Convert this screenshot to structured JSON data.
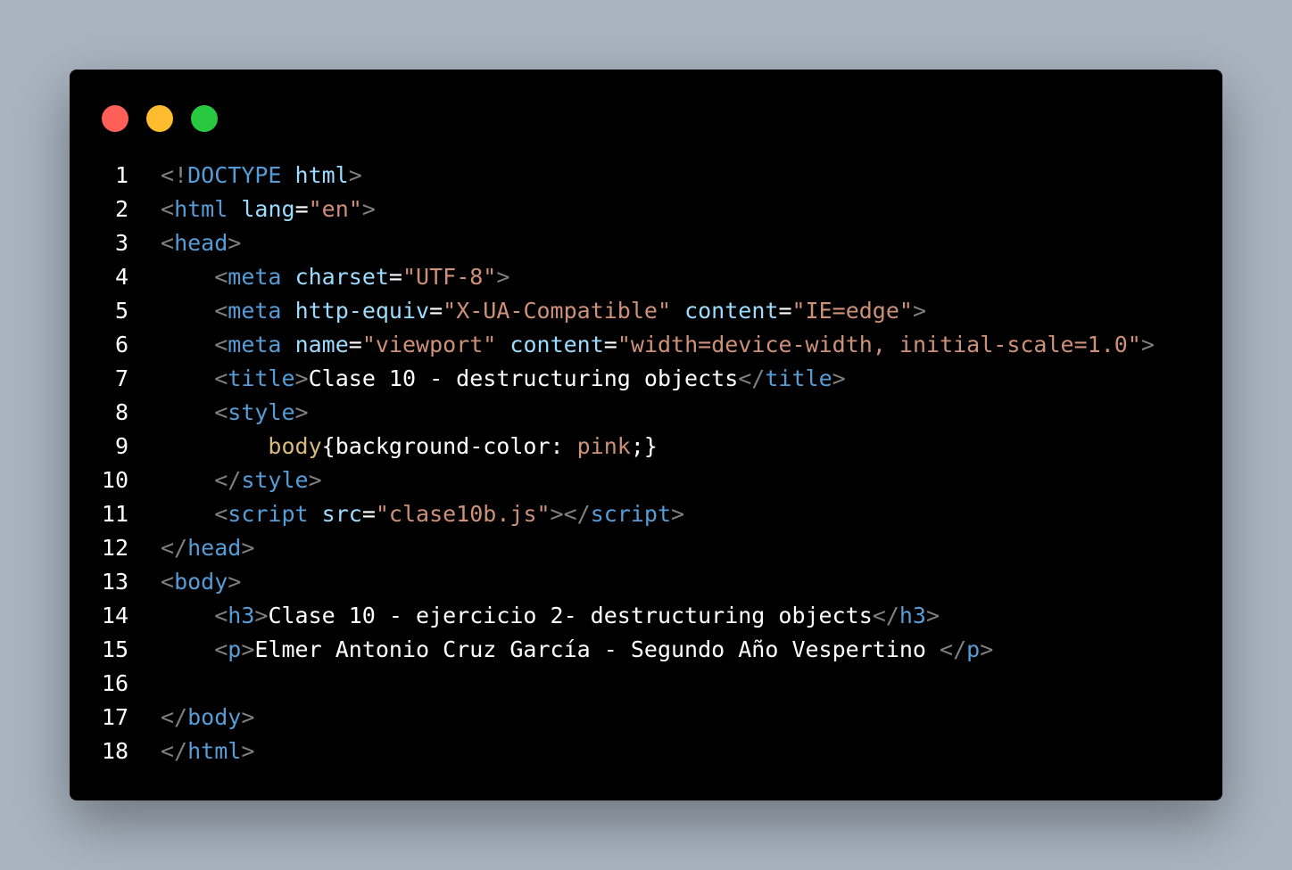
{
  "window": {
    "controls": [
      "close",
      "minimize",
      "maximize"
    ],
    "control_colors": {
      "close": "#ff5f57",
      "minimize": "#febc2e",
      "maximize": "#28c840"
    }
  },
  "code": {
    "lines": [
      {
        "number": "1",
        "tokens": [
          [
            "br",
            "<!"
          ],
          [
            "tg",
            "DOCTYPE"
          ],
          [
            "tx",
            " "
          ],
          [
            "at",
            "html"
          ],
          [
            "br",
            ">"
          ]
        ]
      },
      {
        "number": "2",
        "tokens": [
          [
            "br",
            "<"
          ],
          [
            "tg",
            "html"
          ],
          [
            "tx",
            " "
          ],
          [
            "at",
            "lang"
          ],
          [
            "tx",
            "="
          ],
          [
            "st",
            "\"en\""
          ],
          [
            "br",
            ">"
          ]
        ]
      },
      {
        "number": "3",
        "tokens": [
          [
            "br",
            "<"
          ],
          [
            "tg",
            "head"
          ],
          [
            "br",
            ">"
          ]
        ]
      },
      {
        "number": "4",
        "tokens": [
          [
            "tx",
            "    "
          ],
          [
            "br",
            "<"
          ],
          [
            "tg",
            "meta"
          ],
          [
            "tx",
            " "
          ],
          [
            "at",
            "charset"
          ],
          [
            "tx",
            "="
          ],
          [
            "st",
            "\"UTF-8\""
          ],
          [
            "br",
            ">"
          ]
        ]
      },
      {
        "number": "5",
        "tokens": [
          [
            "tx",
            "    "
          ],
          [
            "br",
            "<"
          ],
          [
            "tg",
            "meta"
          ],
          [
            "tx",
            " "
          ],
          [
            "at",
            "http-equiv"
          ],
          [
            "tx",
            "="
          ],
          [
            "st",
            "\"X-UA-Compatible\""
          ],
          [
            "tx",
            " "
          ],
          [
            "at",
            "content"
          ],
          [
            "tx",
            "="
          ],
          [
            "st",
            "\"IE=edge\""
          ],
          [
            "br",
            ">"
          ]
        ]
      },
      {
        "number": "6",
        "tokens": [
          [
            "tx",
            "    "
          ],
          [
            "br",
            "<"
          ],
          [
            "tg",
            "meta"
          ],
          [
            "tx",
            " "
          ],
          [
            "at",
            "name"
          ],
          [
            "tx",
            "="
          ],
          [
            "st",
            "\"viewport\""
          ],
          [
            "tx",
            " "
          ],
          [
            "at",
            "content"
          ],
          [
            "tx",
            "="
          ],
          [
            "st",
            "\"width=device-width, initial-scale=1.0\""
          ],
          [
            "br",
            ">"
          ]
        ]
      },
      {
        "number": "7",
        "tokens": [
          [
            "tx",
            "    "
          ],
          [
            "br",
            "<"
          ],
          [
            "tg",
            "title"
          ],
          [
            "br",
            ">"
          ],
          [
            "tx",
            "Clase 10 - destructuring objects"
          ],
          [
            "br",
            "</"
          ],
          [
            "tg",
            "title"
          ],
          [
            "br",
            ">"
          ]
        ]
      },
      {
        "number": "8",
        "tokens": [
          [
            "tx",
            "    "
          ],
          [
            "br",
            "<"
          ],
          [
            "tg",
            "style"
          ],
          [
            "br",
            ">"
          ]
        ]
      },
      {
        "number": "9",
        "tokens": [
          [
            "tx",
            "        "
          ],
          [
            "sl",
            "body"
          ],
          [
            "tx",
            "{background-color: "
          ],
          [
            "st",
            "pink"
          ],
          [
            "tx",
            ";}"
          ]
        ]
      },
      {
        "number": "10",
        "tokens": [
          [
            "tx",
            "    "
          ],
          [
            "br",
            "</"
          ],
          [
            "tg",
            "style"
          ],
          [
            "br",
            ">"
          ]
        ]
      },
      {
        "number": "11",
        "tokens": [
          [
            "tx",
            "    "
          ],
          [
            "br",
            "<"
          ],
          [
            "tg",
            "script"
          ],
          [
            "tx",
            " "
          ],
          [
            "at",
            "src"
          ],
          [
            "tx",
            "="
          ],
          [
            "st",
            "\"clase10b.js\""
          ],
          [
            "br",
            "></"
          ],
          [
            "tg",
            "script"
          ],
          [
            "br",
            ">"
          ]
        ]
      },
      {
        "number": "12",
        "tokens": [
          [
            "br",
            "</"
          ],
          [
            "tg",
            "head"
          ],
          [
            "br",
            ">"
          ]
        ]
      },
      {
        "number": "13",
        "tokens": [
          [
            "br",
            "<"
          ],
          [
            "tg",
            "body"
          ],
          [
            "br",
            ">"
          ]
        ]
      },
      {
        "number": "14",
        "tokens": [
          [
            "tx",
            "    "
          ],
          [
            "br",
            "<"
          ],
          [
            "tg",
            "h3"
          ],
          [
            "br",
            ">"
          ],
          [
            "tx",
            "Clase 10 - ejercicio 2- destructuring objects"
          ],
          [
            "br",
            "</"
          ],
          [
            "tg",
            "h3"
          ],
          [
            "br",
            ">"
          ]
        ]
      },
      {
        "number": "15",
        "tokens": [
          [
            "tx",
            "    "
          ],
          [
            "br",
            "<"
          ],
          [
            "tg",
            "p"
          ],
          [
            "br",
            ">"
          ],
          [
            "tx",
            "Elmer Antonio Cruz García - Segundo Año Vespertino "
          ],
          [
            "br",
            "</"
          ],
          [
            "tg",
            "p"
          ],
          [
            "br",
            ">"
          ]
        ]
      },
      {
        "number": "16",
        "tokens": []
      },
      {
        "number": "17",
        "tokens": [
          [
            "br",
            "</"
          ],
          [
            "tg",
            "body"
          ],
          [
            "br",
            ">"
          ]
        ]
      },
      {
        "number": "18",
        "tokens": [
          [
            "br",
            "</"
          ],
          [
            "tg",
            "html"
          ],
          [
            "br",
            ">"
          ]
        ]
      }
    ]
  }
}
